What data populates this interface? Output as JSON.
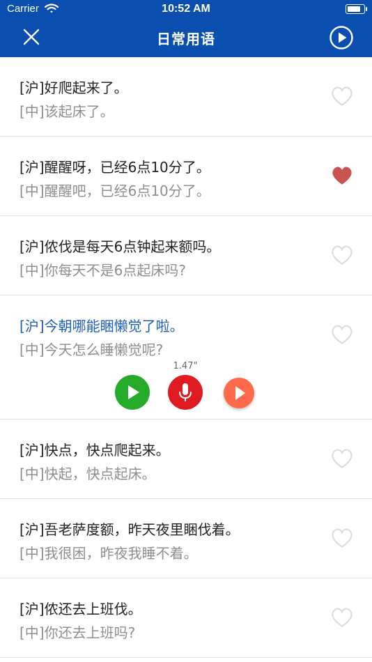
{
  "status_bar": {
    "carrier": "Carrier",
    "time": "10:52 AM",
    "battery_level": 0.9
  },
  "nav": {
    "title": "日常用语",
    "close_icon": "close-icon",
    "play_all_icon": "play-circle-icon"
  },
  "phrases": [
    {
      "dialect": "[沪]好爬起来了。",
      "mandarin": "[中]该起床了。",
      "favorited": false
    },
    {
      "dialect": "[沪]醒醒呀，已经6点10分了。",
      "mandarin": "[中]醒醒吧，已经6点10分了。",
      "favorited": true
    },
    {
      "dialect": "[沪]侬伐是每天6点钟起来额吗。",
      "mandarin": "[中]你每天不是6点起床吗?",
      "favorited": false
    },
    {
      "dialect": "[沪]今朝哪能睏懒觉了啦。",
      "mandarin": "[中]今天怎么睡懒觉呢?",
      "favorited": false
    },
    {
      "dialect": "[沪]快点，快点爬起来。",
      "mandarin": "[中]快起，快点起床。",
      "favorited": false
    },
    {
      "dialect": "[沪]吾老萨度额，昨天夜里睏伐着。",
      "mandarin": "[中]我很困，昨夜我睡不着。",
      "favorited": false
    },
    {
      "dialect": "[沪]侬还去上班伐。",
      "mandarin": "[中]你还去上班吗?",
      "favorited": false
    }
  ],
  "player": {
    "duration": "1.47\"",
    "play_color": "#26ab29",
    "record_color": "#dd1b20",
    "replay_color": "#ff6a4b"
  },
  "colors": {
    "accent": "#0a4fb0",
    "active_text": "#1d5fb8",
    "heart_filled": "#c9534f",
    "heart_outline": "#dcdcdc"
  }
}
